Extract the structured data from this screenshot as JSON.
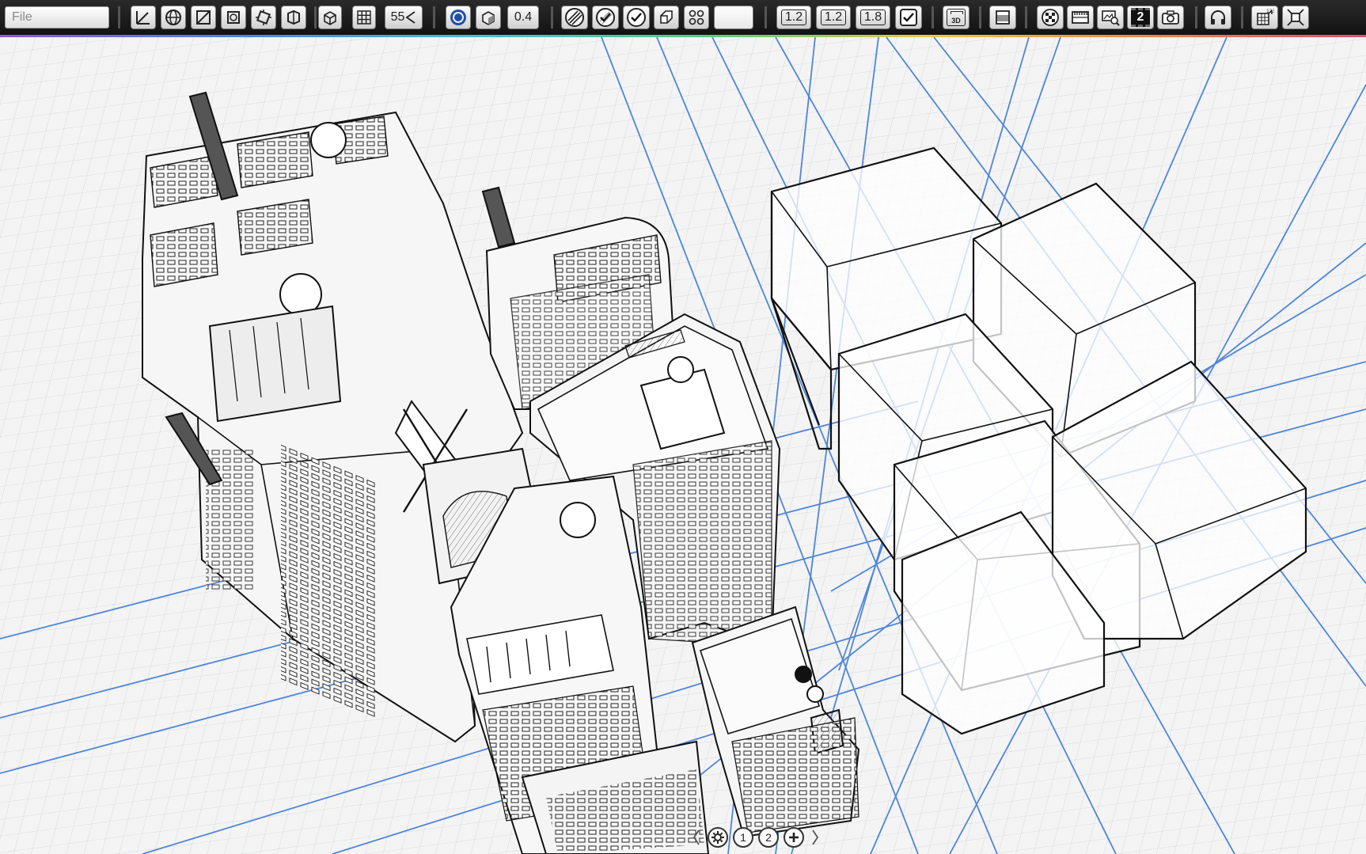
{
  "toolbar": {
    "file_placeholder": "File",
    "fov_value": "55",
    "stroke_value": "0.4",
    "preset_a": "1.2",
    "preset_b": "1.2",
    "preset_c": "1.8",
    "cam_3d": "3D",
    "layer_num": "2"
  },
  "pager": {
    "page_1": "1",
    "page_2": "2"
  }
}
